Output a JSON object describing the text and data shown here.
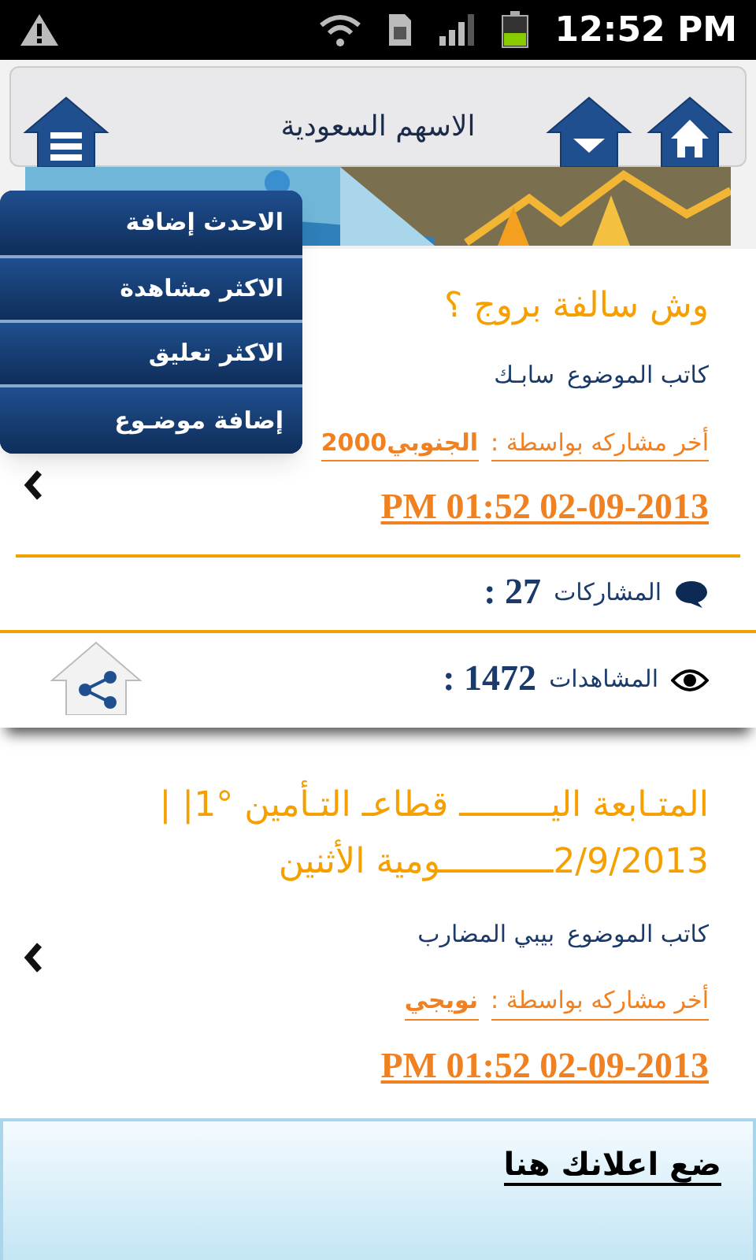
{
  "status_bar": {
    "time": "12:52 PM"
  },
  "header": {
    "title": "الاسهم السعودية"
  },
  "menu": {
    "items": [
      {
        "label": "الاحدث إضافة"
      },
      {
        "label": "الاكثر مشاهدة"
      },
      {
        "label": "الاكثر تعليق"
      },
      {
        "label": "إضافة موضـوع"
      }
    ]
  },
  "posts": [
    {
      "title_lines": [
        "وش سالفة بروج ؟"
      ],
      "author_label": "كاتب الموضوع",
      "author": "سابـك",
      "last_by_label": "أخر مشاركه بواسطة :",
      "last_by": "الجنوبي2000",
      "date": "PM 01:52 02-09-2013",
      "replies_label": "المشاركات",
      "replies": ": 27",
      "views_label": "المشاهدات",
      "views": ": 1472"
    },
    {
      "title_lines": [
        "المتـابعة اليـــــــــ قطاعـ التـأمين °1| |",
        "2/9/2013ـــــــــــومية الأثنين"
      ],
      "author_label": "كاتب الموضوع",
      "author": "بيبي المضارب",
      "last_by_label": "أخر مشاركه بواسطة :",
      "last_by": "نويجي",
      "date": "PM 01:52 02-09-2013"
    }
  ],
  "ad": {
    "text": "ضع اعلانك هنا"
  }
}
